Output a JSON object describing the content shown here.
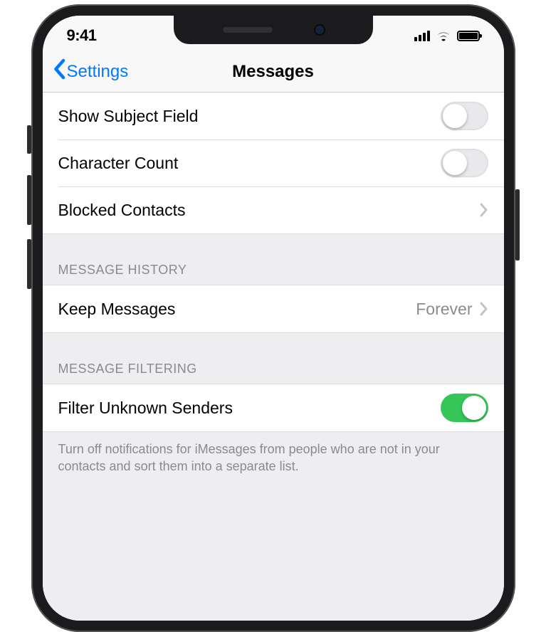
{
  "status": {
    "time": "9:41"
  },
  "nav": {
    "back_label": "Settings",
    "title": "Messages"
  },
  "group1": {
    "show_subject_field": {
      "label": "Show Subject Field",
      "on": false
    },
    "character_count": {
      "label": "Character Count",
      "on": false
    },
    "blocked_contacts": {
      "label": "Blocked Contacts"
    }
  },
  "message_history": {
    "header": "MESSAGE HISTORY",
    "keep_messages": {
      "label": "Keep Messages",
      "value": "Forever"
    }
  },
  "message_filtering": {
    "header": "MESSAGE FILTERING",
    "filter_unknown": {
      "label": "Filter Unknown Senders",
      "on": true
    },
    "footer": "Turn off notifications for iMessages from people who are not in your contacts and sort them into a separate list."
  }
}
